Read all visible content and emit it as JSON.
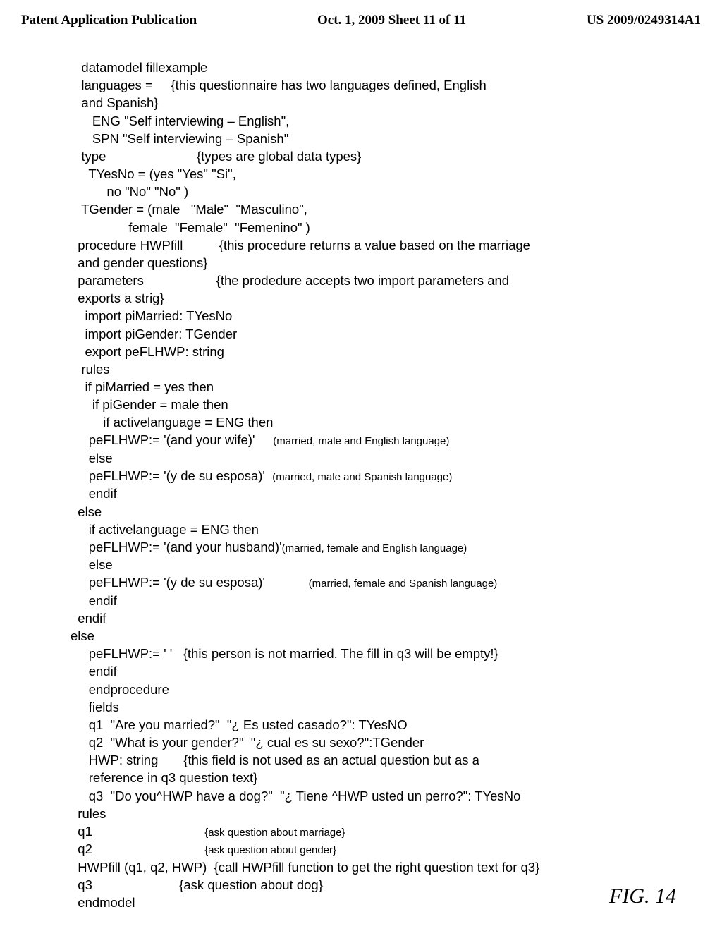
{
  "header": {
    "left": "Patent Application Publication",
    "mid": "Oct. 1, 2009   Sheet 11 of 11",
    "right": "US 2009/0249314A1"
  },
  "lines": {
    "l1": "   datamodel fillexample",
    "l2": "   languages =     {this questionnaire has two languages defined, English",
    "l3": "   and Spanish}",
    "l4": "      ENG \"Self interviewing – English\",",
    "l5": "      SPN \"Self interviewing – Spanish\"",
    "l6": "   type                         {types are global data types}",
    "l7": "     TYesNo = (yes \"Yes\" \"Si\",",
    "l8": "          no \"No\" \"No\" )",
    "l9": "   TGender = (male   \"Male\"  \"Masculino\",",
    "l10": "                female  \"Female\"  \"Femenino\" )",
    "l11": "  procedure HWPfill          {this procedure returns a value based on the marriage",
    "l12": "  and gender questions}",
    "l13": "  parameters                    {the prodedure accepts two import parameters and",
    "l14": "  exports a strig}",
    "l15": "    import piMarried: TYesNo",
    "l16": "    import piGender: TGender",
    "l17": "    export peFLHWP: string",
    "l18": "   rules",
    "l19": "    if piMarried = yes then",
    "l20": "      if piGender = male then",
    "l21": "         if activelanguage = ENG then",
    "l22a": "     peFLHWP:= '(and your wife)'     ",
    "l22b": "(married, male and English language)",
    "l23": "     else",
    "l24a": "     peFLHWP:= '(y de su esposa)'  ",
    "l24b": "(married, male and Spanish language)",
    "l25": "     endif",
    "l26": "  else",
    "l27": "     if activelanguage = ENG then",
    "l28a": "     peFLHWP:= '(and your husband)'",
    "l28b": "(married, female and English language)",
    "l29": "     else",
    "l30a": "     peFLHWP:= '(y de su esposa)'            ",
    "l30b": "(married, female and Spanish language)",
    "l31": "     endif",
    "l32": "  endif",
    "l33": "else",
    "l34": "     peFLHWP:= ' '   {this person is not married. The fill in q3 will be empty!}",
    "l35": "     endif",
    "l36": "     endprocedure",
    "l37": "     fields",
    "l38": "     q1  \"Are you married?\"  \"¿ Es usted casado?\": TYesNO",
    "l39": "     q2  \"What is your gender?\"  \"¿ cual es su sexo?\":TGender",
    "l40": "     HWP: string       {this field is not used as an actual question but as a",
    "l41": "     reference in q3 question text}",
    "l42": "     q3  \"Do you^HWP have a dog?\"  \"¿ Tiene ^HWP usted un perro?\": TYesNo",
    "l43": "  rules",
    "l44a": "  q1                               ",
    "l44b": "{ask question about marriage}",
    "l45a": "  q2                               ",
    "l45b": "{ask question about gender}",
    "l46": "  HWPfill (q1, q2, HWP)  {call HWPfill function to get the right question text for q3}",
    "l47": "  q3                        {ask question about dog}",
    "l48": "  endmodel"
  },
  "fig": "FIG.  14"
}
